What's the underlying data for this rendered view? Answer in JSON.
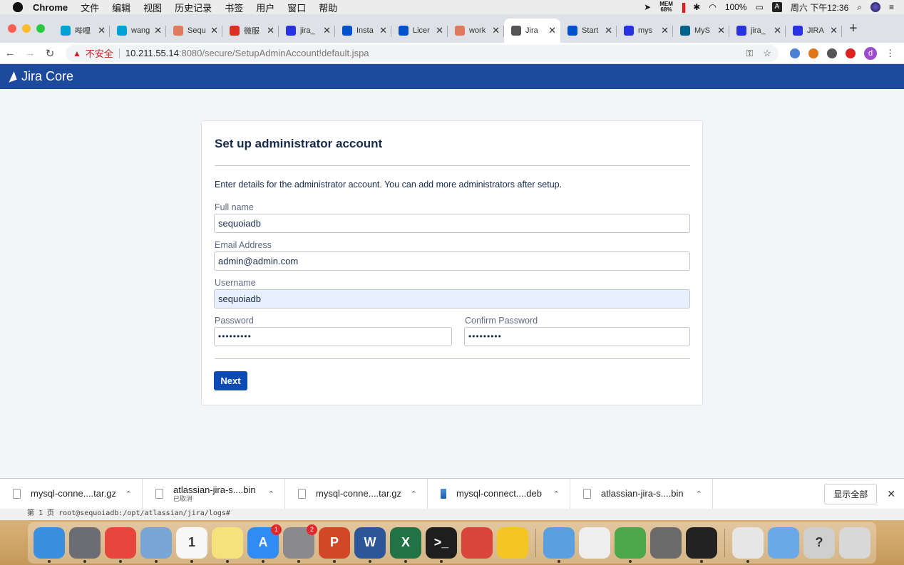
{
  "menubar": {
    "app_name": "Chrome",
    "menus": [
      "文件",
      "编辑",
      "视图",
      "历史记录",
      "书签",
      "用户",
      "窗口",
      "帮助"
    ],
    "mem_label": "MEM",
    "mem_value": "68%",
    "battery": "100%",
    "input_method": "A",
    "clock": "周六 下午12:36"
  },
  "tabs": [
    {
      "label": "哔哩",
      "icon": "bilibili-icon",
      "color": "#00a1d6",
      "active": false
    },
    {
      "label": "wang",
      "icon": "bilibili-icon",
      "color": "#00a1d6",
      "active": false
    },
    {
      "label": "Sequ",
      "icon": "sequoia-icon",
      "color": "#e07a5f",
      "active": false
    },
    {
      "label": "微服",
      "icon": "csdn-icon",
      "color": "#d93025",
      "active": false
    },
    {
      "label": "jira_",
      "icon": "baidu-paw-icon",
      "color": "#2932e1",
      "active": false
    },
    {
      "label": "Insta",
      "icon": "atlassian-icon",
      "color": "#0052cc",
      "active": false
    },
    {
      "label": "Licer",
      "icon": "atlassian-icon",
      "color": "#0052cc",
      "active": false
    },
    {
      "label": "work",
      "icon": "sequoia-icon",
      "color": "#e07a5f",
      "active": false
    },
    {
      "label": "Jira",
      "icon": "globe-icon",
      "color": "#555555",
      "active": true
    },
    {
      "label": "Start",
      "icon": "atlassian-icon",
      "color": "#0052cc",
      "active": false
    },
    {
      "label": "mys",
      "icon": "baidu-paw-icon",
      "color": "#2932e1",
      "active": false
    },
    {
      "label": "MyS",
      "icon": "mysql-icon",
      "color": "#00618a",
      "active": false
    },
    {
      "label": "jira_",
      "icon": "baidu-paw-icon",
      "color": "#2932e1",
      "active": false
    },
    {
      "label": "JIRA",
      "icon": "baidu-paw-icon",
      "color": "#2932e1",
      "active": false
    }
  ],
  "address": {
    "insecure_label": "不安全",
    "host": "10.211.55.14",
    "path": ":8080/secure/SetupAdminAccount!default.jspa",
    "profile_initial": "d"
  },
  "jira": {
    "product_name": "Jira Core",
    "brand_color": "#1e4a9e"
  },
  "setup": {
    "title": "Set up administrator account",
    "intro": "Enter details for the administrator account. You can add more administrators after setup.",
    "fullname_label": "Full name",
    "fullname_value": "sequoiadb",
    "email_label": "Email Address",
    "email_value": "admin@admin.com",
    "username_label": "Username",
    "username_value": "sequoiadb",
    "password_label": "Password",
    "password_value": "•••••••••",
    "confirm_label": "Confirm Password",
    "confirm_value": "•••••••••",
    "next_label": "Next"
  },
  "downloads": {
    "items": [
      {
        "name": "mysql-conne....tar.gz",
        "status": ""
      },
      {
        "name": "atlassian-jira-s....bin",
        "status": "已取消"
      },
      {
        "name": "mysql-conne....tar.gz",
        "status": ""
      },
      {
        "name": "mysql-connect....deb",
        "status": ""
      },
      {
        "name": "atlassian-jira-s....bin",
        "status": ""
      }
    ],
    "show_all_label": "显示全部"
  },
  "terminal_peek": "第 1 页  root@sequoiadb:/opt/atlassian/jira/logs# ",
  "dock": {
    "apps": [
      {
        "name": "finder-icon",
        "color": "#3b8fe0",
        "glyph": "",
        "badge": ""
      },
      {
        "name": "launchpad-icon",
        "color": "#6c6c75",
        "glyph": "",
        "badge": ""
      },
      {
        "name": "chrome-icon",
        "color": "#e8453c",
        "glyph": "",
        "badge": ""
      },
      {
        "name": "mail-icon",
        "color": "#7aa6d6",
        "glyph": "",
        "badge": ""
      },
      {
        "name": "calendar-icon",
        "color": "#f7f7f7",
        "glyph": "1",
        "badge": ""
      },
      {
        "name": "notes-icon",
        "color": "#f5e27a",
        "glyph": "",
        "badge": ""
      },
      {
        "name": "app-store-icon",
        "color": "#2f8cf5",
        "glyph": "A",
        "badge": "1"
      },
      {
        "name": "system-preferences-icon",
        "color": "#8a8a8e",
        "glyph": "",
        "badge": "2"
      },
      {
        "name": "powerpoint-icon",
        "color": "#d24726",
        "glyph": "P",
        "badge": ""
      },
      {
        "name": "word-icon",
        "color": "#2b579a",
        "glyph": "W",
        "badge": ""
      },
      {
        "name": "excel-icon",
        "color": "#217346",
        "glyph": "X",
        "badge": ""
      },
      {
        "name": "terminal-icon",
        "color": "#1e1e1e",
        "glyph": ">_",
        "badge": ""
      },
      {
        "name": "remote-desktop-icon",
        "color": "#d9453d",
        "glyph": "",
        "badge": ""
      },
      {
        "name": "bee-icon",
        "color": "#f3c623",
        "glyph": "",
        "badge": ""
      },
      {
        "name": "parallels-windows-icon",
        "color": "#5aa0e0",
        "glyph": "",
        "badge": ""
      },
      {
        "name": "textedit-icon",
        "color": "#eeeeee",
        "glyph": "",
        "badge": ""
      },
      {
        "name": "xmind-icon",
        "color": "#4aa84a",
        "glyph": "",
        "badge": ""
      },
      {
        "name": "calculator-icon",
        "color": "#6b6b6b",
        "glyph": "",
        "badge": ""
      },
      {
        "name": "parallels-terminal-icon",
        "color": "#222222",
        "glyph": "",
        "badge": ""
      },
      {
        "name": "archive-icon",
        "color": "#e6e6e6",
        "glyph": "",
        "badge": ""
      },
      {
        "name": "windows-folder-icon",
        "color": "#6aa8e8",
        "glyph": "",
        "badge": ""
      },
      {
        "name": "help-icon",
        "color": "#cfcfcf",
        "glyph": "?",
        "badge": ""
      },
      {
        "name": "trash-icon",
        "color": "#d8d8d8",
        "glyph": "",
        "badge": ""
      }
    ]
  }
}
